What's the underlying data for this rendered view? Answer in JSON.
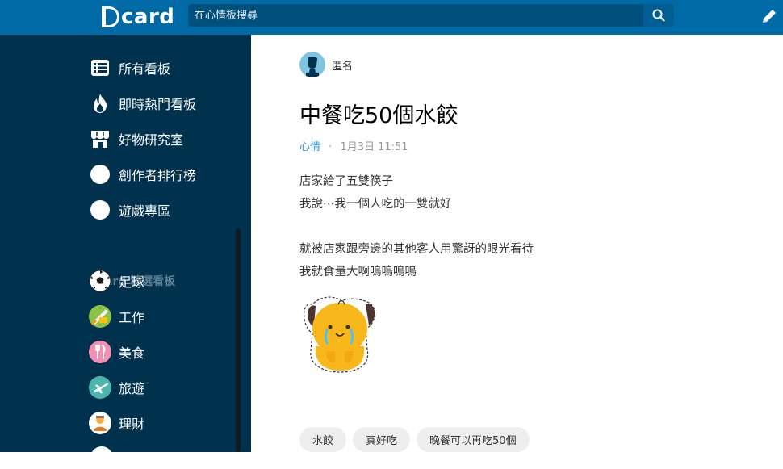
{
  "header": {
    "logo_text": "card",
    "search_placeholder": "在心情板搜尋"
  },
  "sidebar": {
    "main_items": [
      {
        "label": "所有看板",
        "icon": "board-list-icon"
      },
      {
        "label": "即時熱門看板",
        "icon": "fire-icon"
      },
      {
        "label": "好物研究室",
        "icon": "shop-icon"
      },
      {
        "label": "創作者排行榜",
        "icon": "circle-icon"
      },
      {
        "label": "遊戲專區",
        "icon": "circle-icon"
      }
    ],
    "section_title": "Dcard 精選看板",
    "boards": [
      {
        "label": "足球",
        "icon": "soccer-ball-icon"
      },
      {
        "label": "工作",
        "icon": "work-icon"
      },
      {
        "label": "美食",
        "icon": "fork-knife-icon"
      },
      {
        "label": "旅遊",
        "icon": "airplane-icon"
      },
      {
        "label": "理財",
        "icon": "finance-icon"
      }
    ]
  },
  "post": {
    "author": "匿名",
    "title": "中餐吃50個水餃",
    "board": "心情",
    "separator": "·",
    "timestamp": "1月3日 11:51",
    "body_lines": [
      "店家給了五雙筷子",
      "我說⋯我一個人吃的一雙就好",
      "",
      "就被店家跟旁邊的其他客人用驚訝的眼光看待",
      "我就食量大啊嗚嗚嗚嗚"
    ],
    "tags": [
      "水餃",
      "真好吃",
      "晚餐可以再吃50個"
    ]
  },
  "colors": {
    "header_bg": "#006aa6",
    "sidebar_bg": "#00324e",
    "accent": "#3397cf"
  }
}
